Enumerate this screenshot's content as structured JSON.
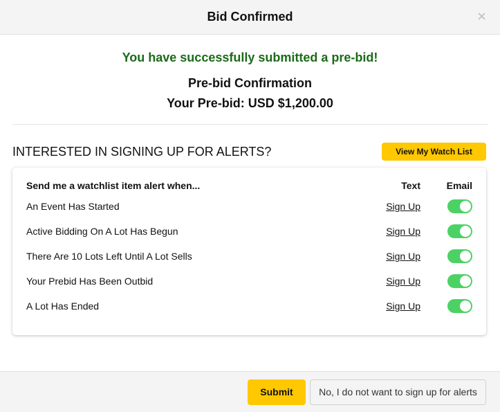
{
  "header": {
    "title": "Bid Confirmed",
    "close_icon": "×"
  },
  "confirmation": {
    "success_message": "You have successfully submitted a pre-bid!",
    "title": "Pre-bid Confirmation",
    "amount_line": "Your Pre-bid: USD $1,200.00"
  },
  "alerts": {
    "question": "INTERESTED IN SIGNING UP FOR ALERTS?",
    "watch_list_button": "View My Watch List",
    "table": {
      "header_label": "Send me a watchlist item alert when...",
      "header_text": "Text",
      "header_email": "Email",
      "rows": [
        {
          "label": "An Event Has Started",
          "text_action": "Sign Up",
          "email_enabled": true
        },
        {
          "label": "Active Bidding On A Lot Has Begun",
          "text_action": "Sign Up",
          "email_enabled": true
        },
        {
          "label": "There Are 10 Lots Left Until A Lot Sells",
          "text_action": "Sign Up",
          "email_enabled": true
        },
        {
          "label": "Your Prebid Has Been Outbid",
          "text_action": "Sign Up",
          "email_enabled": true
        },
        {
          "label": "A Lot Has Ended",
          "text_action": "Sign Up",
          "email_enabled": true
        }
      ]
    }
  },
  "footer": {
    "submit_label": "Submit",
    "decline_label": "No, I do not want to sign up for alerts"
  },
  "colors": {
    "accent_yellow": "#ffc800",
    "success_green": "#1a6b17",
    "toggle_on": "#4cd264"
  }
}
